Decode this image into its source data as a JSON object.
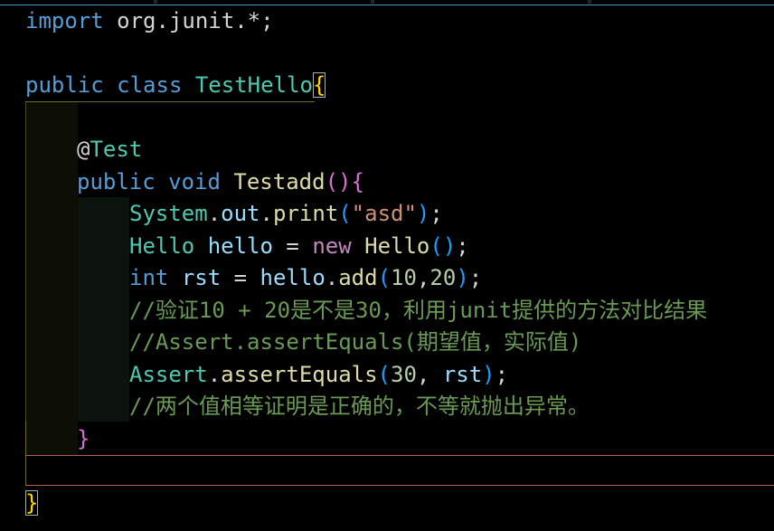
{
  "editor": {
    "theme_colors": {
      "background": "#000000",
      "keyword": "#569cd6",
      "class": "#4ec9b0",
      "function": "#dcdcaa",
      "variable": "#9cdcfe",
      "string": "#ce9178",
      "number": "#b5cea8",
      "comment": "#6a9955",
      "bracket_level1": "#ffd700",
      "bracket_level2": "#da70d6",
      "bracket_level3": "#179fff"
    },
    "lines": [
      {
        "tokens": [
          "import",
          "org.junit.*;"
        ]
      },
      {
        "tokens": []
      },
      {
        "tokens": [
          "public",
          "class",
          "TestHello",
          "{"
        ]
      },
      {
        "tokens": []
      },
      {
        "tokens": [
          "@Test"
        ]
      },
      {
        "tokens": [
          "public",
          "void",
          "Testadd",
          "(",
          ")",
          "{"
        ]
      },
      {
        "tokens": [
          "System",
          ".",
          "out",
          ".",
          "print",
          "(",
          "\"asd\"",
          ")",
          ";"
        ]
      },
      {
        "tokens": [
          "Hello",
          "hello",
          "=",
          "new",
          "Hello",
          "(",
          ")",
          ";"
        ]
      },
      {
        "tokens": [
          "int",
          "rst",
          "=",
          "hello",
          ".",
          "add",
          "(",
          "10",
          ",",
          "20",
          ")",
          ";"
        ]
      },
      {
        "tokens": [
          "//验证10 + 20是不是30，利用junit提供的方法对比结果"
        ]
      },
      {
        "tokens": [
          "//Assert.assertEquals(期望值，实际值)"
        ]
      },
      {
        "tokens": [
          "Assert",
          ".",
          "assertEquals",
          "(",
          "30",
          ", ",
          "rst",
          ")",
          ";"
        ]
      },
      {
        "tokens": [
          "//两个值相等证明是正确的，不等就抛出异常。"
        ]
      },
      {
        "tokens": [
          "}"
        ]
      },
      {
        "tokens": []
      },
      {
        "tokens": [
          "}"
        ]
      }
    ]
  }
}
